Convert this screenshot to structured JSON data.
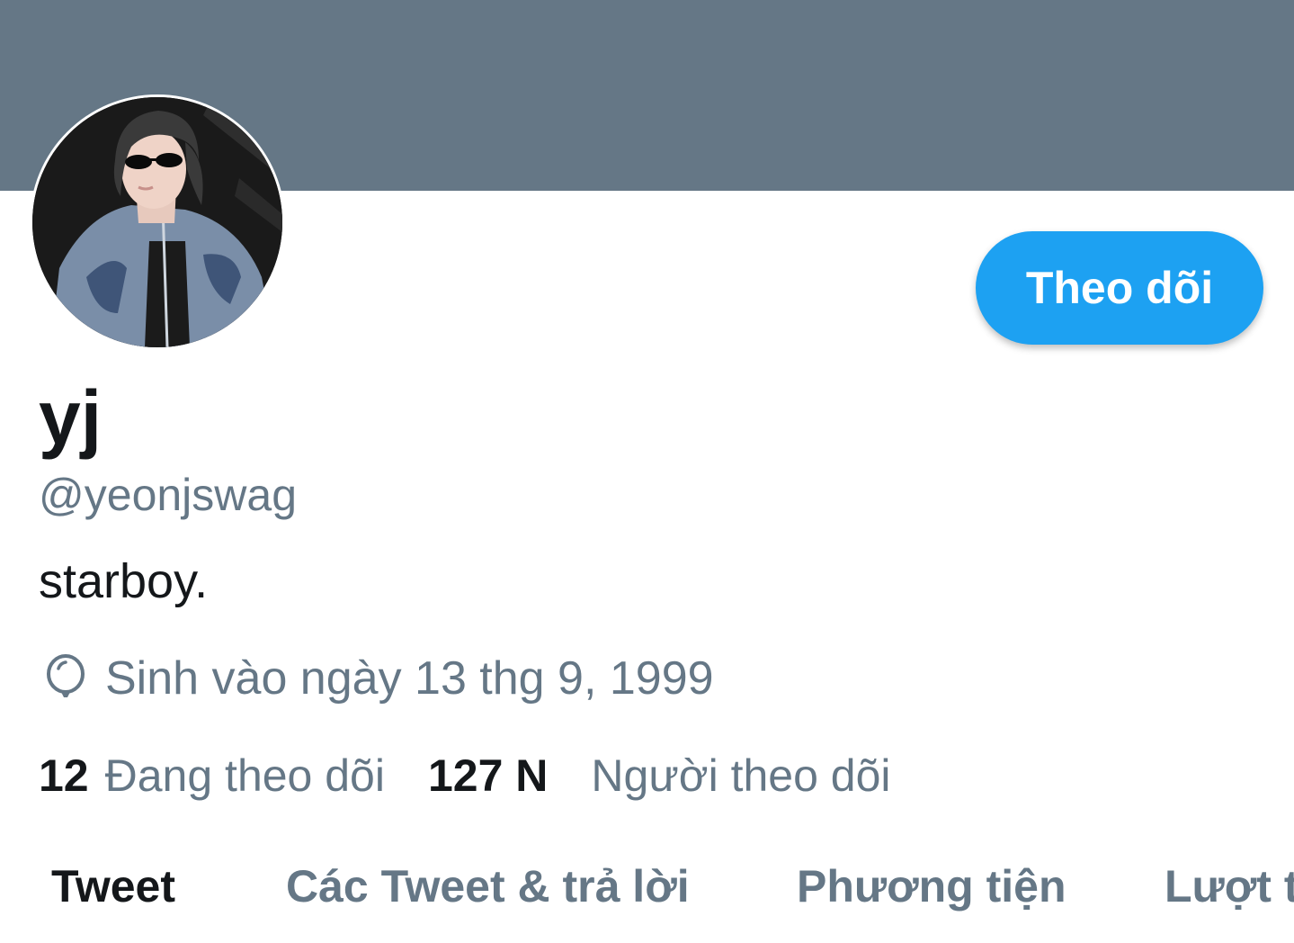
{
  "profile": {
    "display_name": "yj",
    "handle": "@yeonjswag",
    "bio": "starboy.",
    "birthday": "Sinh vào ngày 13 thg 9, 1999"
  },
  "actions": {
    "follow_label": "Theo dõi"
  },
  "stats": {
    "following_count": "12",
    "following_label": "Đang theo dõi",
    "followers_count": "127 N",
    "followers_label": "Người theo dõi"
  },
  "tabs": [
    {
      "label": "Tweet",
      "active": true
    },
    {
      "label": "Các Tweet & trả lời",
      "active": false
    },
    {
      "label": "Phương tiện",
      "active": false
    },
    {
      "label": "Lượt t",
      "active": false
    }
  ],
  "colors": {
    "banner": "#657786",
    "accent": "#1da1f2",
    "text_primary": "#14171a",
    "text_secondary": "#657786"
  },
  "icons": {
    "avatar": "profile-photo",
    "birthday": "balloon-icon"
  }
}
